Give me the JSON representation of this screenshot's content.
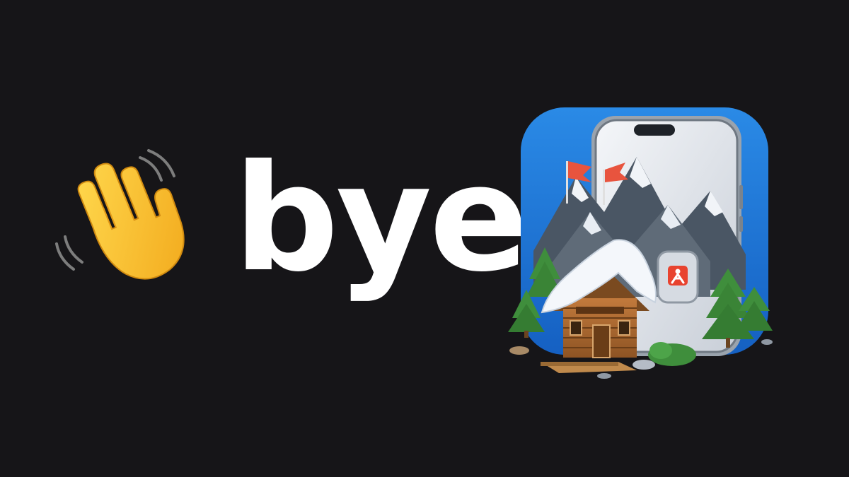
{
  "title": "bye",
  "icons": {
    "left": "waving-hand-icon",
    "right": "alpine-cabin-app-icon"
  },
  "colors": {
    "background": "#161518",
    "text": "#ffffff",
    "hand": "#f7c531",
    "icon_background": "#1e7bd9",
    "flag": "#e8543e"
  }
}
